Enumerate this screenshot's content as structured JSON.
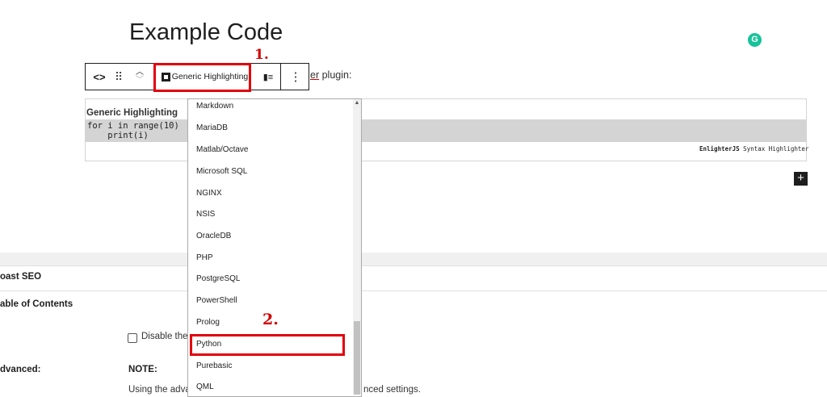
{
  "page_title": "Example Code",
  "toolbar": {
    "code_icon_glyph": "<>",
    "drag_glyph": "⠿",
    "move_up_glyph": "︿",
    "move_down_glyph": "﹀",
    "language_label": "Generic Highlighting",
    "align_glyph": "▮≡",
    "more_glyph": "⋮",
    "trailing_text_prefix": "er",
    "trailing_text_suffix": " plugin:"
  },
  "annotations": {
    "step1": "1.",
    "step2": "2.",
    "highlight_color": "#e3000b"
  },
  "code_block": {
    "language_label": "Generic Highlighting",
    "code": "for i in range(10)\n    print(i)",
    "footer_brand": "EnlighterJS",
    "footer_text": " Syntax Highlighter"
  },
  "add_block_glyph": "+",
  "grammarly_glyph": "G",
  "dropdown": {
    "options": [
      "Markdown",
      "MariaDB",
      "Matlab/Octave",
      "Microsoft SQL",
      "NGINX",
      "NSIS",
      "OracleDB",
      "PHP",
      "PostgreSQL",
      "PowerShell",
      "Prolog",
      "Python",
      "Purebasic",
      "QML"
    ],
    "highlighted": "Python",
    "scroll_up_glyph": "▲"
  },
  "panels": {
    "yoast": "oast SEO",
    "toc": "able of Contents",
    "disable_label": "Disable the a",
    "advanced": "dvanced:",
    "note": "NOTE:",
    "using_text": "Using the advan",
    "using_text_tail": "nced settings."
  },
  "colors": {
    "accent_red": "#e3000b",
    "grammarly_green": "#15c39a",
    "code_band": "#d4d4d4"
  }
}
